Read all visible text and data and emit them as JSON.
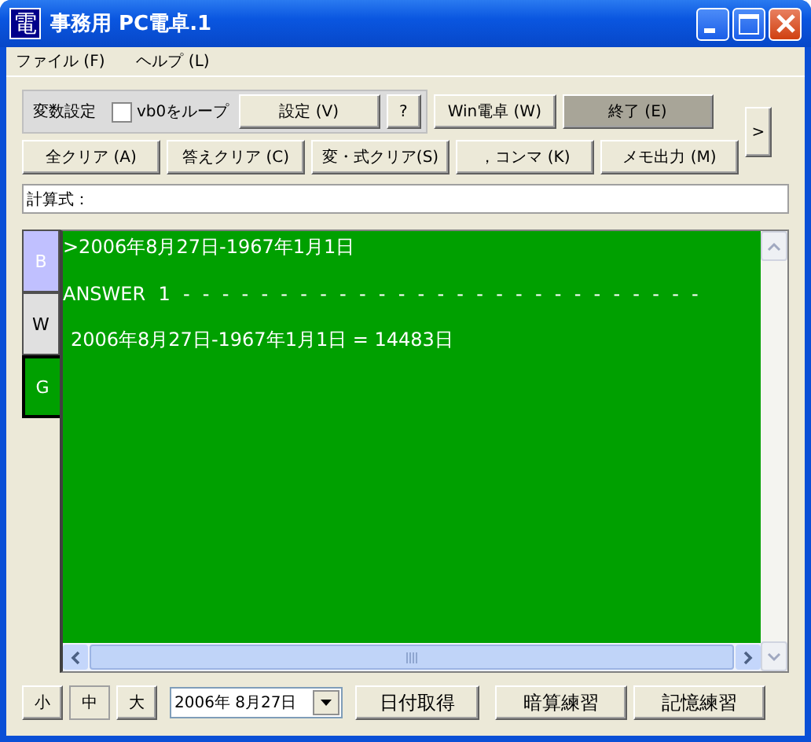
{
  "window": {
    "icon": "電",
    "title": "事務用 PC電卓.1"
  },
  "menu": [
    "ファイル (F)",
    "ヘルプ (L)"
  ],
  "variable_group": {
    "label": "変数設定",
    "loop_checkbox": {
      "label": "vb0をループ",
      "checked": false
    },
    "buttons": [
      "設定 (V)",
      "?"
    ]
  },
  "toolbar_row_1": [
    {
      "label": "Win電卓 (W)",
      "pressed": false
    },
    {
      "label": "終了 (E)",
      "pressed": true
    }
  ],
  "toolbar_row_2": [
    {
      "label": "全クリア (A)"
    },
    {
      "label": "答えクリア (C)"
    },
    {
      "label": "変・式クリア(S)"
    },
    {
      "label": "，コンマ (K)"
    },
    {
      "label": "メモ出力 (M)"
    }
  ],
  "expand_button": ">",
  "formula": {
    "label": "計算式："
  },
  "side_tabs": [
    {
      "label": "B",
      "color": "#c0c0ff",
      "selected": false
    },
    {
      "label": "W",
      "color": "#e0e0e0",
      "selected": false
    },
    {
      "label": "G",
      "color": "#00a000",
      "selected": true
    }
  ],
  "output_lines": [
    {
      "kind": "input",
      "text": ">2006年8月27日-1967年1月1日"
    },
    {
      "kind": "answer_header",
      "text": "ANSWER 1 - - - - - - - - - - - - - - - - - - - - - - - - - - -"
    },
    {
      "kind": "result",
      "text": "2006年8月27日-1967年1月1日 = 14483日"
    }
  ],
  "size_buttons": [
    {
      "label": "小",
      "selected": false
    },
    {
      "label": "中",
      "selected": true
    },
    {
      "label": "大",
      "selected": false
    }
  ],
  "date_picker": {
    "value": "2006年  8月27日"
  },
  "bottom_buttons": [
    "日付取得",
    "暗算練習",
    "記憶練習"
  ]
}
